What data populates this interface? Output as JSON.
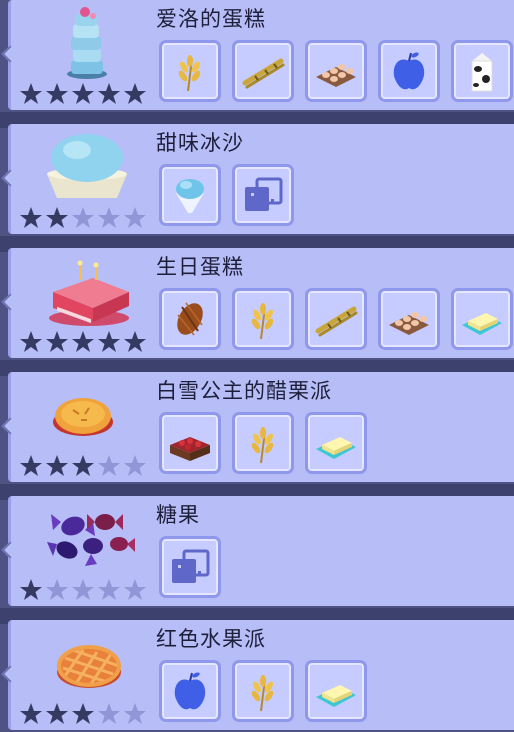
{
  "recipes": [
    {
      "name": "爱洛的蛋糕",
      "dish": "stacked-cake-icon",
      "stars": 5,
      "ingredients": [
        "wheat-icon",
        "sugarcane-icon",
        "eggs-icon",
        "apple-icon",
        "milk-icon"
      ]
    },
    {
      "name": "甜味冰沙",
      "dish": "shaved-ice-icon",
      "stars": 2,
      "ingredients": [
        "ice-icon",
        "any-ingredient-icon"
      ]
    },
    {
      "name": "生日蛋糕",
      "dish": "birthday-cake-icon",
      "stars": 5,
      "ingredients": [
        "cocoa-icon",
        "wheat-icon",
        "sugarcane-icon",
        "eggs-icon",
        "butter-icon"
      ]
    },
    {
      "name": "白雪公主的醋栗派",
      "dish": "gooseberry-pie-icon",
      "stars": 3,
      "ingredients": [
        "berries-crate-icon",
        "wheat-icon",
        "butter-icon"
      ]
    },
    {
      "name": "糖果",
      "dish": "candy-icon",
      "stars": 1,
      "ingredients": [
        "any-ingredient-icon"
      ]
    },
    {
      "name": "红色水果派",
      "dish": "red-fruit-pie-icon",
      "stars": 3,
      "ingredients": [
        "apple-icon",
        "wheat-icon",
        "butter-icon"
      ]
    }
  ],
  "max_stars": 5,
  "colors": {
    "card": "#b7bdf6",
    "slot": "#c6ccff",
    "star_filled": "#353a62",
    "star_empty": "#9096d6"
  }
}
